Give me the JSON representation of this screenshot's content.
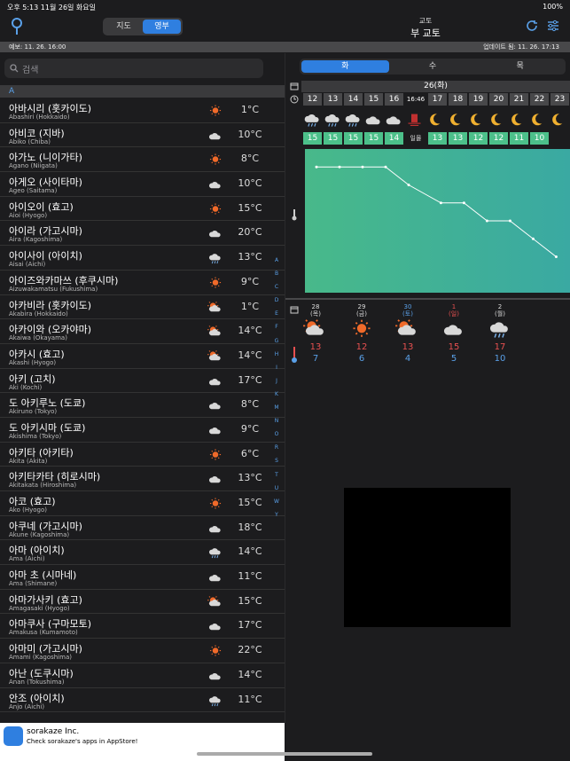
{
  "status": {
    "left": "오후 5:13   11월 26일 화요일",
    "right": "100%"
  },
  "top": {
    "seg": [
      "지도",
      "영부"
    ],
    "loc_sub": "교토",
    "loc_main": "부 교토"
  },
  "info": {
    "left": "예보: 11. 26. 16:00",
    "right": "업데이트 됨: 11. 26. 17:13"
  },
  "search": {
    "placeholder": "검색"
  },
  "section": "A",
  "cities": [
    {
      "n": "아바시리 (홋카이도)",
      "e": "Abashiri (Hokkaido)",
      "icon": "sun",
      "t": "1°C"
    },
    {
      "n": "아비코 (지바)",
      "e": "Abiko (Chiba)",
      "icon": "cloud",
      "t": "10°C"
    },
    {
      "n": "아가노 (니이가타)",
      "e": "Agano (Niigata)",
      "icon": "sun",
      "t": "8°C"
    },
    {
      "n": "아게오 (사이타마)",
      "e": "Ageo (Saitama)",
      "icon": "cloud",
      "t": "10°C"
    },
    {
      "n": "아이오이 (효고)",
      "e": "Aioi (Hyogo)",
      "icon": "sun",
      "t": "15°C"
    },
    {
      "n": "아이라 (가고시마)",
      "e": "Aira (Kagoshima)",
      "icon": "cloud",
      "t": "20°C"
    },
    {
      "n": "아이사이 (아이치)",
      "e": "Aisai (Aichi)",
      "icon": "rain",
      "t": "13°C"
    },
    {
      "n": "아이즈와카마쓰 (후쿠시마)",
      "e": "Aizuwakamatsu (Fukushima)",
      "icon": "sun",
      "t": "9°C"
    },
    {
      "n": "아카비라 (홋카이도)",
      "e": "Akabira (Hokkaido)",
      "icon": "sun-cloud",
      "t": "1°C"
    },
    {
      "n": "아카이와 (오카야마)",
      "e": "Akaiwa (Okayama)",
      "icon": "sun-cloud",
      "t": "14°C"
    },
    {
      "n": "아카시 (효고)",
      "e": "Akashi (Hyogo)",
      "icon": "sun-cloud",
      "t": "14°C"
    },
    {
      "n": "아키 (고치)",
      "e": "Aki (Kochi)",
      "icon": "cloud",
      "t": "17°C"
    },
    {
      "n": "도 아키루노 (도쿄)",
      "e": "Akiruno (Tokyo)",
      "icon": "cloud",
      "t": "8°C"
    },
    {
      "n": "도 아키시마 (도쿄)",
      "e": "Akishima (Tokyo)",
      "icon": "cloud",
      "t": "9°C"
    },
    {
      "n": "아키타 (아키타)",
      "e": "Akita (Akita)",
      "icon": "sun",
      "t": "6°C"
    },
    {
      "n": "아키타카타 (히로시마)",
      "e": "Akitakata (Hiroshima)",
      "icon": "cloud",
      "t": "13°C"
    },
    {
      "n": "아코 (효고)",
      "e": "Ako (Hyogo)",
      "icon": "sun",
      "t": "15°C"
    },
    {
      "n": "아쿠네 (가고시마)",
      "e": "Akune (Kagoshima)",
      "icon": "cloud",
      "t": "18°C"
    },
    {
      "n": "아마 (아이치)",
      "e": "Ama (Aichi)",
      "icon": "rain",
      "t": "14°C"
    },
    {
      "n": "아마 초 (시마네)",
      "e": "Ama (Shimane)",
      "icon": "cloud",
      "t": "11°C"
    },
    {
      "n": "아마가사키 (효고)",
      "e": "Amagasaki (Hyogo)",
      "icon": "sun-cloud",
      "t": "15°C"
    },
    {
      "n": "아마쿠사 (구마모토)",
      "e": "Amakusa (Kumamoto)",
      "icon": "cloud",
      "t": "17°C"
    },
    {
      "n": "아마미 (가고시마)",
      "e": "Amami (Kagoshima)",
      "icon": "sun",
      "t": "22°C"
    },
    {
      "n": "아난 (도쿠시마)",
      "e": "Anan (Tokushima)",
      "icon": "cloud",
      "t": "14°C"
    },
    {
      "n": "안조 (아이치)",
      "e": "Anjo (Aichi)",
      "icon": "rain",
      "t": "11°C"
    }
  ],
  "index": [
    "A",
    "B",
    "C",
    "D",
    "E",
    "F",
    "G",
    "H",
    "I",
    "J",
    "K",
    "M",
    "N",
    "O",
    "R",
    "S",
    "T",
    "U",
    "W",
    "Y"
  ],
  "days": [
    "화",
    "수",
    "목"
  ],
  "dayhead": "26(화)",
  "hours": [
    "12",
    "13",
    "14",
    "15",
    "16",
    "16:46",
    "17",
    "18",
    "19",
    "20",
    "21",
    "22",
    "23"
  ],
  "hour_icons": [
    "rain",
    "rain",
    "rain",
    "cloud",
    "cloud",
    "sunset",
    "moon",
    "moon",
    "moon",
    "moon",
    "moon",
    "moon",
    "moon"
  ],
  "hour_temps": [
    "15",
    "15",
    "15",
    "15",
    "14",
    "일몰",
    "13",
    "13",
    "12",
    "12",
    "11",
    "10"
  ],
  "daily": [
    {
      "d": "28",
      "w": "(목)",
      "icon": "sun-cloud",
      "hi": "13",
      "lo": "7"
    },
    {
      "d": "29",
      "w": "(금)",
      "icon": "sun",
      "hi": "12",
      "lo": "6"
    },
    {
      "d": "30",
      "w": "(토)",
      "icon": "sun-cloud",
      "hi": "13",
      "lo": "4"
    },
    {
      "d": "1",
      "w": "(일)",
      "icon": "cloud",
      "hi": "15",
      "lo": "5"
    },
    {
      "d": "2",
      "w": "(월)",
      "icon": "rain",
      "hi": "17",
      "lo": "10"
    }
  ],
  "ad": {
    "title": "sorakaze Inc.",
    "text": "Check sorakaze's apps in AppStore!"
  }
}
